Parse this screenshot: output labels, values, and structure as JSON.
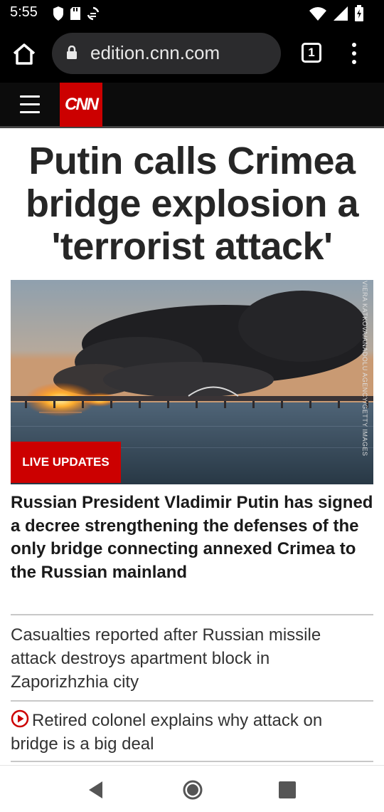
{
  "status_bar": {
    "time": "5:55",
    "icons_left": [
      "shield-icon",
      "sd-card-icon",
      "sync-icon"
    ],
    "icons_right": [
      "wifi-icon",
      "signal-icon",
      "battery-icon"
    ]
  },
  "browser": {
    "url": "edition.cnn.com",
    "tab_count": "1"
  },
  "cnn_header": {
    "logo": "CNN"
  },
  "article": {
    "headline": "Putin calls Crimea bridge explosion a 'terrorist attack'",
    "badge": "LIVE UPDATES",
    "photo_credit": "VIERA KATKOVA/ANADOLU AGENCY/GETTY IMAGES",
    "summary": "Russian President Vladimir Putin has signed a decree strengthening the defenses of the only bridge connecting annexed Crimea to the Russian mainland"
  },
  "stories": [
    {
      "text": "Casualties reported after Russian missile attack destroys apartment block in Zaporizhzhia city",
      "video": false
    },
    {
      "text": "Retired colonel explains why attack on bridge is a big deal",
      "video": true
    }
  ],
  "colors": {
    "cnn_red": "#cc0000",
    "status_bg": "#000000",
    "url_box": "#2b2b2d"
  }
}
